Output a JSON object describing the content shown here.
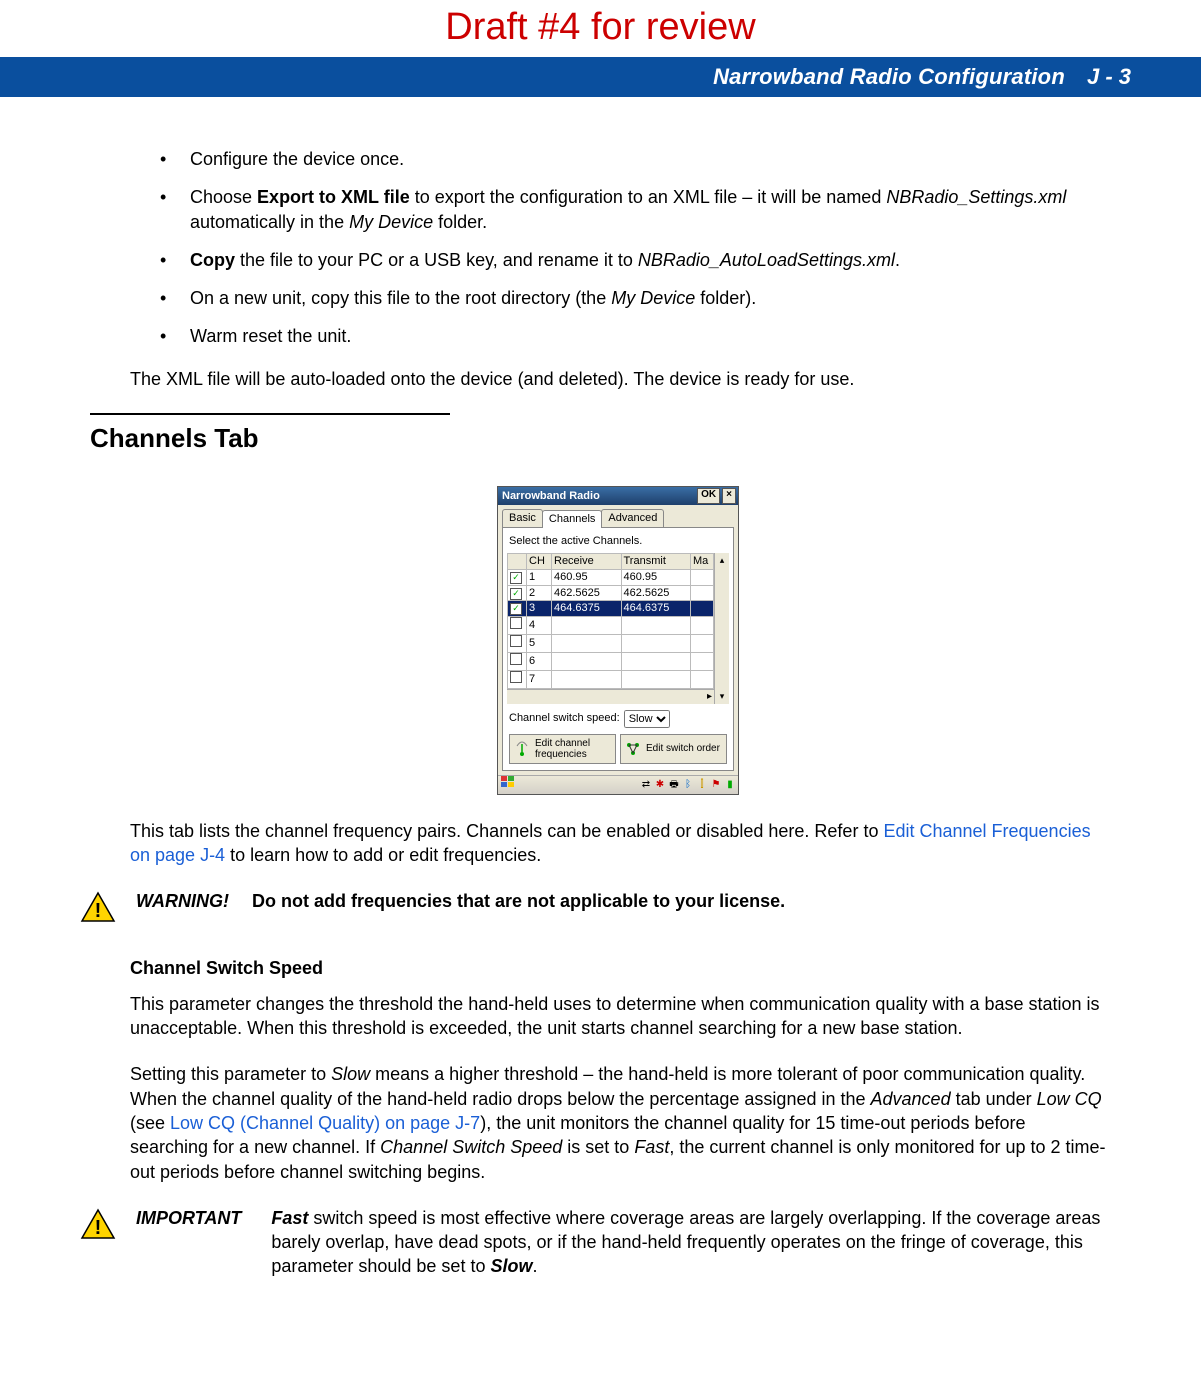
{
  "draft_header": "Draft #4 for review",
  "header": {
    "title": "Narrowband Radio Configuration",
    "page": "J - 3"
  },
  "bullets": {
    "b1": "Configure the device once.",
    "b2_pre": "Choose ",
    "b2_bold": "Export to XML file",
    "b2_mid": " to export the configuration to an XML file – it will be named ",
    "b2_it1": "NBRadio_Settings.xml",
    "b2_mid2": " automatically in the ",
    "b2_it2": "My Device",
    "b2_end": " folder.",
    "b3_bold": "Copy",
    "b3_mid": " the file to your PC or a USB key, and rename it to ",
    "b3_it": "NBRadio_AutoLoadSettings.xml",
    "b3_end": ".",
    "b4_pre": "On a new unit, copy this file to the root directory (the ",
    "b4_it": "My Device",
    "b4_end": " folder).",
    "b5": "Warm reset the unit."
  },
  "after_list": "The XML file will be auto-loaded onto the device (and deleted). The device is ready for use.",
  "section_heading": "Channels Tab",
  "window": {
    "title": "Narrowband Radio",
    "ok": "OK",
    "close": "×",
    "tabs": {
      "basic": "Basic",
      "channels": "Channels",
      "advanced": "Advanced"
    },
    "instruction": "Select the active Channels.",
    "cols": {
      "ch": "CH",
      "rx": "Receive",
      "tx": "Transmit",
      "ma": "Ma"
    },
    "rows": [
      {
        "checked": true,
        "ch": "1",
        "rx": "460.95",
        "tx": "460.95",
        "sel": false
      },
      {
        "checked": true,
        "ch": "2",
        "rx": "462.5625",
        "tx": "462.5625",
        "sel": false
      },
      {
        "checked": true,
        "ch": "3",
        "rx": "464.6375",
        "tx": "464.6375",
        "sel": true
      },
      {
        "checked": false,
        "ch": "4",
        "rx": "",
        "tx": "",
        "sel": false
      },
      {
        "checked": false,
        "ch": "5",
        "rx": "",
        "tx": "",
        "sel": false
      },
      {
        "checked": false,
        "ch": "6",
        "rx": "",
        "tx": "",
        "sel": false
      },
      {
        "checked": false,
        "ch": "7",
        "rx": "",
        "tx": "",
        "sel": false
      }
    ],
    "switch_label": "Channel switch speed:",
    "switch_value": "Slow",
    "btn_freq": "Edit channel frequencies",
    "btn_order": "Edit switch order"
  },
  "para1_pre": "This tab lists the channel frequency pairs. Channels can be enabled or disabled here. Refer to ",
  "para1_link": "Edit Channel Frequencies on page J-4",
  "para1_end": " to learn how to add or edit frequencies.",
  "warning": {
    "label": "WARNING!",
    "msg": "Do not add frequencies that are not applicable to your license."
  },
  "subheading": "Channel Switch Speed",
  "para2": "This parameter changes the threshold the hand-held uses to determine when communication quality with a base station is unacceptable. When this threshold is exceeded, the unit starts channel searching for a new base station.",
  "para3": {
    "t1": "Setting this parameter to ",
    "i_slow": "Slow",
    "t2": " means a higher threshold – the hand-held is more tolerant of poor communication quality. When the channel quality of the hand-held radio drops below the percentage assigned in the ",
    "i_adv": "Advanced",
    "t3": " tab under ",
    "i_low": "Low CQ",
    "t4": " (see ",
    "link": "Low CQ (Channel Quality) on page J-7",
    "t5": "), the unit monitors the channel quality for 15 time-out periods before searching for a new channel. If ",
    "i_css": "Channel Switch Speed",
    "t6": " is set to ",
    "i_fast": "Fast",
    "t7": ", the current channel is only monitored for up to 2 time-out periods before channel switching begins."
  },
  "important": {
    "label": "IMPORTANT",
    "pre": "",
    "i_fast": "Fast",
    "mid": " switch speed is most effective where coverage areas are largely overlapping. If the coverage areas barely overlap, have dead spots, or if the hand-held frequently operates on the fringe of coverage, this parameter should be set to ",
    "i_slow": "Slow",
    "end": "."
  }
}
